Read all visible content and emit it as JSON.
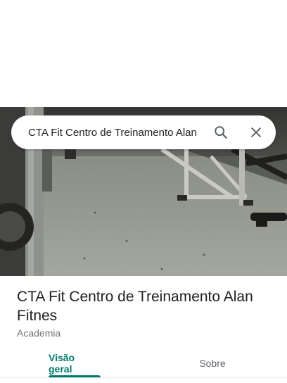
{
  "search": {
    "query": "CTA Fit Centro de Treinamento Alan",
    "search_icon": "search-icon",
    "close_icon": "close-icon"
  },
  "hero": {
    "image_icon": "gym-photo"
  },
  "place": {
    "name": "CTA Fit Centro de Treinamento Alan Fitnes",
    "category": "Academia"
  },
  "tabs": [
    {
      "label": "Visão geral",
      "selected": true
    },
    {
      "label": "Sobre",
      "selected": false
    }
  ],
  "colors": {
    "accent": "#00796b",
    "text_primary": "#202124",
    "text_secondary": "#70757a"
  }
}
